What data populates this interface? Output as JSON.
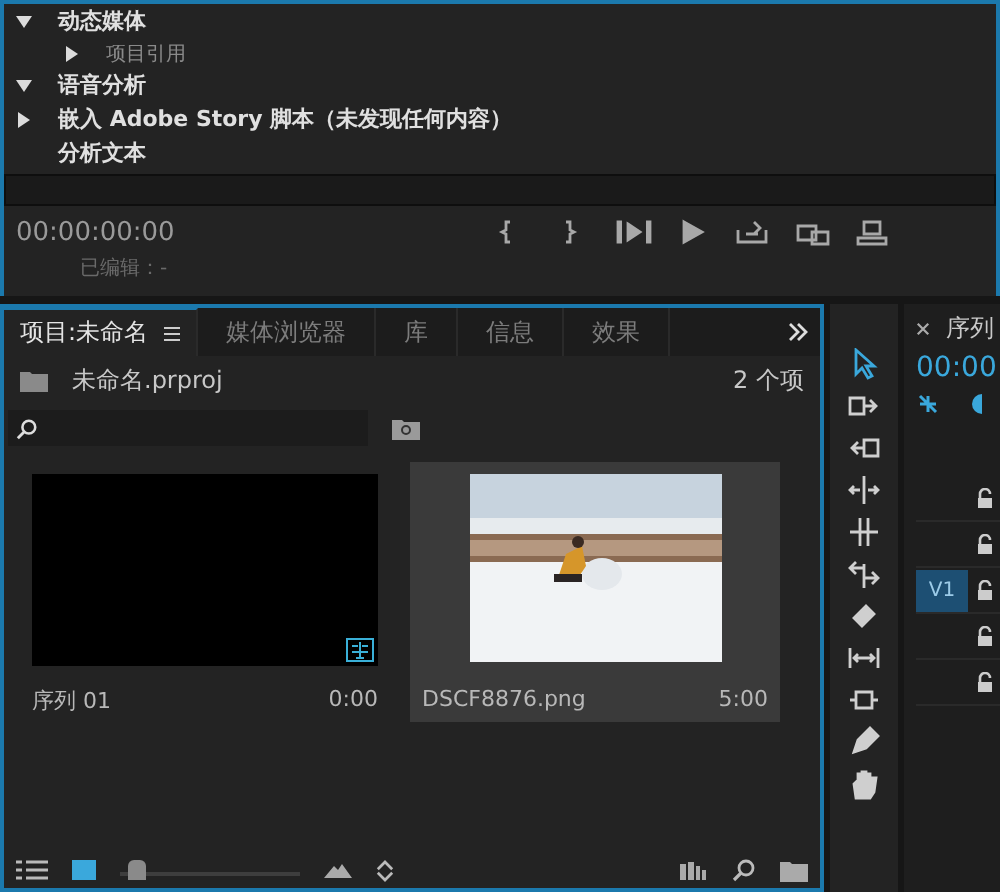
{
  "metadata": [
    {
      "label": "动态媒体",
      "expanded": true,
      "children": [
        {
          "label": "项目引用",
          "expanded": false
        }
      ]
    },
    {
      "label": "语音分析",
      "expanded": true,
      "children": [
        {
          "label": "嵌入 Adobe Story 脚本（未发现任何内容）",
          "expanded": false
        },
        {
          "label": "分析文本"
        }
      ]
    }
  ],
  "source_monitor": {
    "timecode": "00:00:00:00",
    "edited": "已编辑：-",
    "controls": [
      {
        "kind": "mark-in"
      },
      {
        "kind": "mark-out"
      },
      {
        "kind": "go-in-out"
      },
      {
        "kind": "play"
      },
      {
        "kind": "insert"
      },
      {
        "kind": "overwrite"
      },
      {
        "kind": "export-frame"
      }
    ]
  },
  "tabs": [
    {
      "label": "项目:未命名",
      "selected": true
    },
    {
      "label": "媒体浏览器",
      "selected": false
    },
    {
      "label": "库",
      "selected": false
    },
    {
      "label": "信息",
      "selected": false
    },
    {
      "label": "效果",
      "selected": false
    }
  ],
  "project": {
    "file": "未命名.prproj",
    "count": "2 个项",
    "items": [
      {
        "kind": "sequence",
        "name": "序列 01",
        "duration": "0:00",
        "selected": false
      },
      {
        "kind": "picture",
        "name": "DSCF8876.png",
        "duration": "5:00",
        "selected": true
      }
    ],
    "zoom": {
      "level": 0.04
    }
  },
  "tools": [
    {
      "kind": "select",
      "selected": true
    },
    {
      "kind": "track-forward",
      "selected": false
    },
    {
      "kind": "track-backward",
      "selected": false
    },
    {
      "kind": "ripple",
      "selected": false
    },
    {
      "kind": "rolling",
      "selected": false
    },
    {
      "kind": "rate",
      "selected": false
    },
    {
      "kind": "razor",
      "selected": false
    },
    {
      "kind": "slip",
      "selected": false
    },
    {
      "kind": "slide",
      "selected": false
    },
    {
      "kind": "pen",
      "selected": false
    },
    {
      "kind": "hand",
      "selected": false
    }
  ],
  "timeline": {
    "tab": "序列",
    "timecode": "00:00",
    "tracks": [
      {
        "selected": false
      },
      {
        "selected": false
      },
      {
        "label": "V1",
        "selected": true
      },
      {
        "selected": false
      },
      {
        "selected": false
      }
    ]
  }
}
